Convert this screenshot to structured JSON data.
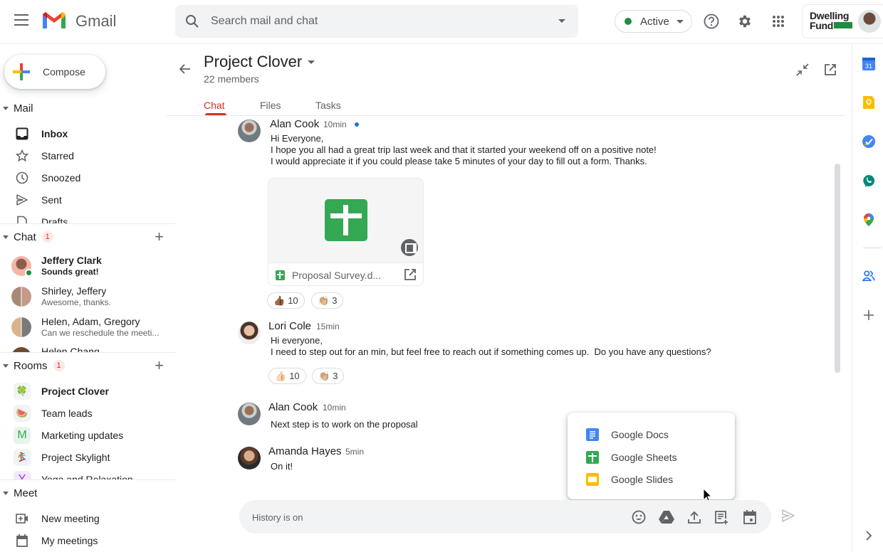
{
  "header": {
    "app_name": "Gmail",
    "search_placeholder": "Search mail and chat",
    "status_label": "Active",
    "status_color": "#1e8e3e",
    "brand_line1": "Dwelling",
    "brand_line2": "Fund",
    "icons": [
      "menu-icon",
      "gmail-logo",
      "search-icon",
      "help-icon",
      "settings-icon",
      "apps-icon"
    ]
  },
  "sidebar": {
    "compose_label": "Compose",
    "mail": {
      "label": "Mail",
      "items": [
        {
          "label": "Inbox",
          "icon": "inbox-icon",
          "bold": true
        },
        {
          "label": "Starred",
          "icon": "star-icon"
        },
        {
          "label": "Snoozed",
          "icon": "clock-icon"
        },
        {
          "label": "Sent",
          "icon": "send-icon"
        },
        {
          "label": "Drafts",
          "icon": "draft-icon"
        }
      ]
    },
    "chat": {
      "label": "Chat",
      "badge": "1",
      "items": [
        {
          "name": "Jeffery Clark",
          "preview": "Sounds great!",
          "bold": true,
          "online": true
        },
        {
          "name": "Shirley, Jeffery",
          "preview": "Awesome, thanks."
        },
        {
          "name": "Helen, Adam, Gregory",
          "preview": "Can we reschedule the meeti..."
        },
        {
          "name": "Helen Chang",
          "preview": ""
        }
      ]
    },
    "rooms": {
      "label": "Rooms",
      "badge": "1",
      "items": [
        {
          "label": "Project Clover",
          "icon": "🍀",
          "bold": true
        },
        {
          "label": "Team leads",
          "icon": "🍉"
        },
        {
          "label": "Marketing updates",
          "icon": "M"
        },
        {
          "label": "Project Skylight",
          "icon": "🏂"
        },
        {
          "label": "Yoga and Relaxation",
          "icon": "Y"
        }
      ]
    },
    "meet": {
      "label": "Meet",
      "items": [
        {
          "label": "New meeting",
          "icon": "video-add-icon"
        },
        {
          "label": "My meetings",
          "icon": "calendar-icon"
        }
      ]
    }
  },
  "main": {
    "title": "Project Clover",
    "members": "22 members",
    "tabs": [
      {
        "label": "Chat",
        "active": true
      },
      {
        "label": "Files"
      },
      {
        "label": "Tasks"
      }
    ],
    "messages": [
      {
        "author": "Alan Cook",
        "time": "10min",
        "unread": true,
        "lines": [
          "Hi Everyone,",
          "I hope you all had a great trip last week and that it started your weekend off on a positive note!",
          "I would appreciate it if you could please take 5 minutes of your day to fill out a form. Thanks."
        ],
        "attachment": {
          "filename": "Proposal Survey.d...",
          "type": "Google Sheets"
        },
        "reactions": [
          {
            "emoji": "👍🏾",
            "count": "10"
          },
          {
            "emoji": "👏🏼",
            "count": "3"
          }
        ]
      },
      {
        "author": "Lori Cole",
        "time": "15min",
        "lines": [
          "Hi everyone,",
          "I need to step out for an min, but feel free to reach out if something comes up.  Do you have any questions?"
        ],
        "reactions": [
          {
            "emoji": "👍🏻",
            "count": "10"
          },
          {
            "emoji": "👏🏼",
            "count": "3"
          }
        ]
      },
      {
        "author": "Alan Cook",
        "time": "10min",
        "lines": [
          "Next step is to work on the proposal"
        ]
      },
      {
        "author": "Amanda Hayes",
        "time": "5min",
        "lines": [
          "On it!"
        ]
      }
    ],
    "popup": {
      "items": [
        {
          "label": "Google Docs",
          "color": "#4285f4"
        },
        {
          "label": "Google Sheets",
          "color": "#34a853"
        },
        {
          "label": "Google Slides",
          "color": "#fbbc04"
        }
      ]
    },
    "composer": {
      "placeholder": "History is on",
      "tools": [
        "emoji-icon",
        "drive-icon",
        "upload-icon",
        "create-doc-icon",
        "calendar-event-icon"
      ]
    }
  },
  "rail": {
    "apps": [
      "Calendar",
      "Keep",
      "Tasks",
      "Chat",
      "Maps",
      "Contacts"
    ],
    "calendar_day": "31"
  }
}
